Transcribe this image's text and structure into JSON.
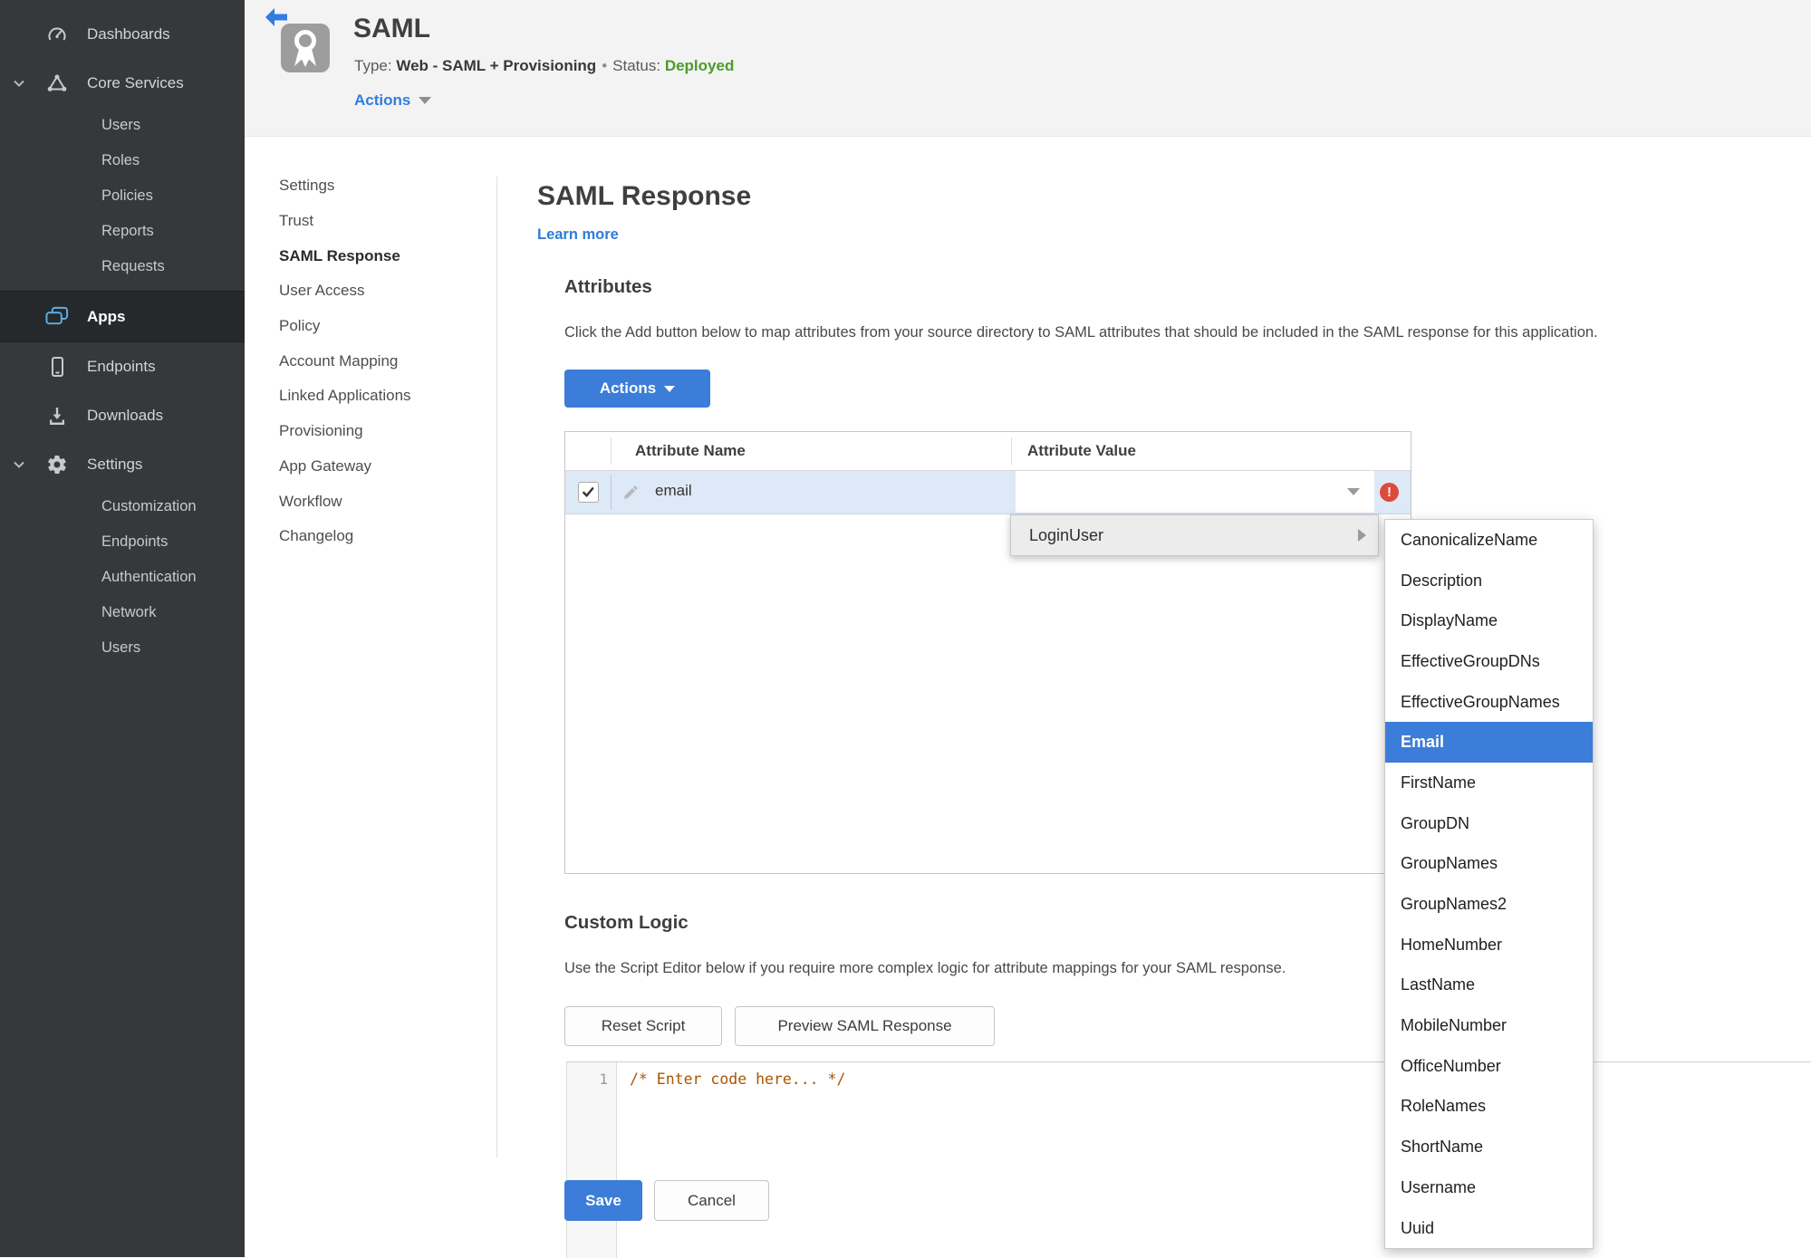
{
  "colors": {
    "accent_blue": "#3b7dd8",
    "link_blue": "#2e7cd6",
    "status_green": "#4e9a2e",
    "error_red": "#dc4b3c",
    "apps_icon_blue": "#5fb0e8",
    "code_comment": "#aa5500",
    "sidebar_bg": "#35393c",
    "row_highlight": "#dde9f7"
  },
  "sidebar": {
    "items": [
      {
        "label": "Dashboards",
        "icon": "gauge-icon",
        "level": "main"
      },
      {
        "label": "Core Services",
        "icon": "core-services-icon",
        "level": "main",
        "expanded": true
      },
      {
        "label": "Users",
        "level": "sub"
      },
      {
        "label": "Roles",
        "level": "sub"
      },
      {
        "label": "Policies",
        "level": "sub"
      },
      {
        "label": "Reports",
        "level": "sub"
      },
      {
        "label": "Requests",
        "level": "sub"
      },
      {
        "label": "Apps",
        "icon": "apps-icon",
        "level": "main",
        "active": true
      },
      {
        "label": "Endpoints",
        "icon": "phone-icon",
        "level": "main"
      },
      {
        "label": "Downloads",
        "icon": "download-icon",
        "level": "main"
      },
      {
        "label": "Settings",
        "icon": "gear-icon",
        "level": "main",
        "expanded": true
      },
      {
        "label": "Customization",
        "level": "sub"
      },
      {
        "label": "Endpoints",
        "level": "sub"
      },
      {
        "label": "Authentication",
        "level": "sub"
      },
      {
        "label": "Network",
        "level": "sub"
      },
      {
        "label": "Users",
        "level": "sub"
      }
    ]
  },
  "header": {
    "app_title": "SAML",
    "type_label": "Type:",
    "type_value": "Web - SAML + Provisioning",
    "dot": "•",
    "status_label": "Status:",
    "status_value": "Deployed",
    "actions_label": "Actions"
  },
  "subnav": {
    "items": [
      {
        "label": "Settings"
      },
      {
        "label": "Trust"
      },
      {
        "label": "SAML Response",
        "active": true
      },
      {
        "label": "User Access"
      },
      {
        "label": "Policy"
      },
      {
        "label": "Account Mapping"
      },
      {
        "label": "Linked Applications"
      },
      {
        "label": "Provisioning"
      },
      {
        "label": "App Gateway"
      },
      {
        "label": "Workflow"
      },
      {
        "label": "Changelog"
      }
    ]
  },
  "main": {
    "title": "SAML Response",
    "learn_more": "Learn more",
    "attributes": {
      "heading": "Attributes",
      "description": "Click the Add button below to map attributes from your source directory to SAML attributes that should be included in the SAML response for this application.",
      "actions_button": "Actions",
      "table": {
        "col_name": "Attribute Name",
        "col_value": "Attribute Value",
        "row": {
          "name": "email",
          "value": "",
          "checked": true,
          "error_mark": "!"
        }
      }
    },
    "custom_logic": {
      "heading": "Custom Logic",
      "description": "Use the Script Editor below if you require more complex logic for attribute mappings for your SAML response.",
      "reset_button": "Reset Script",
      "preview_button": "Preview SAML Response",
      "editor": {
        "line_number": "1",
        "code": "/* Enter code here... */"
      }
    },
    "save_button": "Save",
    "cancel_button": "Cancel"
  },
  "dropdown": {
    "parent_label": "LoginUser",
    "items": [
      {
        "label": "CanonicalizeName"
      },
      {
        "label": "Description"
      },
      {
        "label": "DisplayName"
      },
      {
        "label": "EffectiveGroupDNs"
      },
      {
        "label": "EffectiveGroupNames"
      },
      {
        "label": "Email",
        "selected": true
      },
      {
        "label": "FirstName"
      },
      {
        "label": "GroupDN"
      },
      {
        "label": "GroupNames"
      },
      {
        "label": "GroupNames2"
      },
      {
        "label": "HomeNumber"
      },
      {
        "label": "LastName"
      },
      {
        "label": "MobileNumber"
      },
      {
        "label": "OfficeNumber"
      },
      {
        "label": "RoleNames"
      },
      {
        "label": "ShortName"
      },
      {
        "label": "Username"
      },
      {
        "label": "Uuid"
      }
    ]
  }
}
